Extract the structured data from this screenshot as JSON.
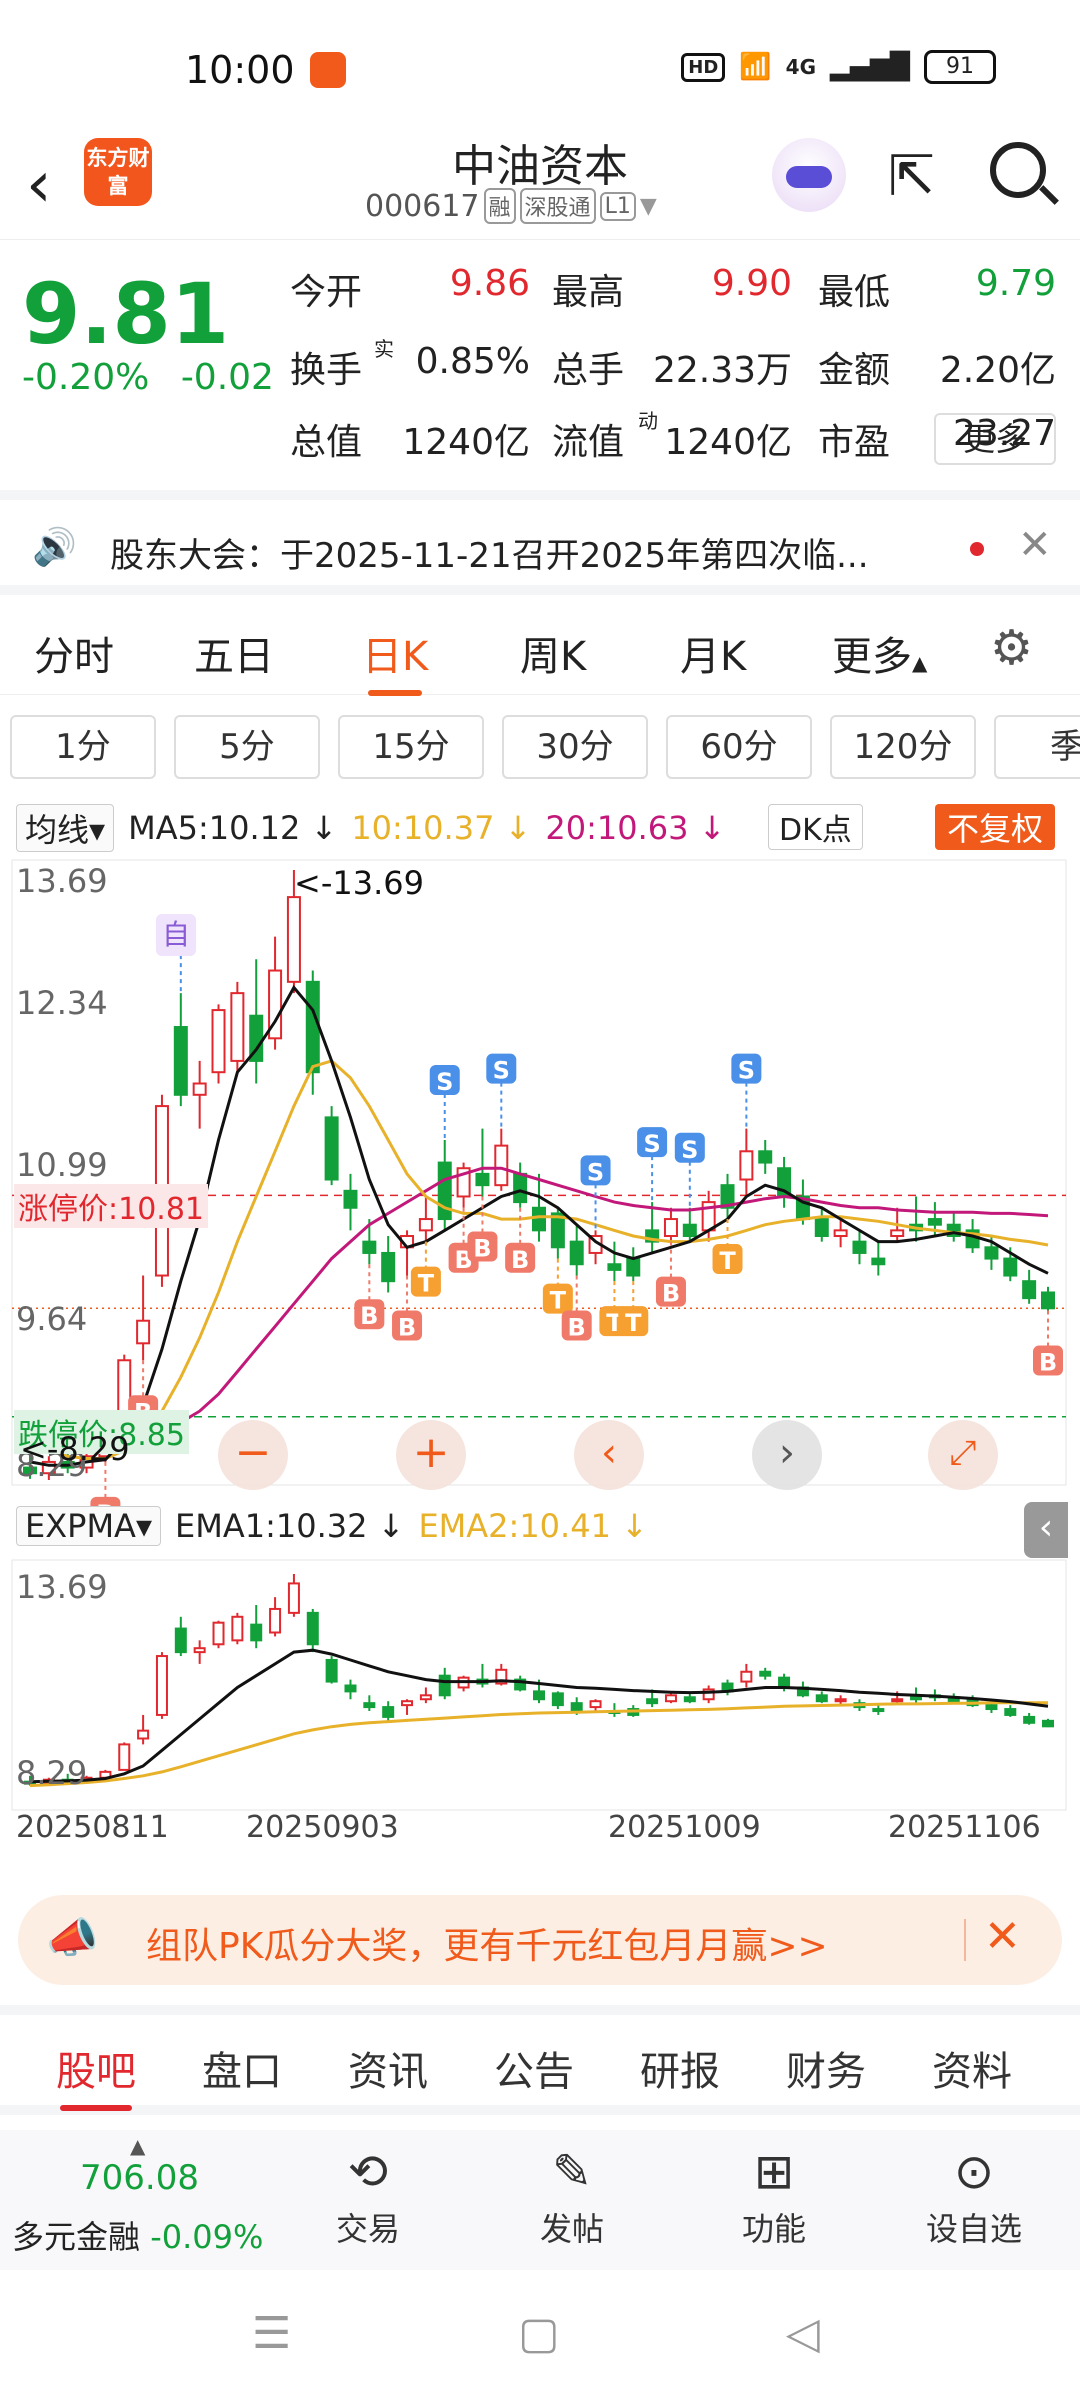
{
  "status": {
    "time": "10:00",
    "hd": "HD",
    "net": "4G",
    "battery": "91"
  },
  "header": {
    "logo": "东方财富",
    "title": "中油资本",
    "code": "000617",
    "tags": [
      "融",
      "深股通",
      "L1"
    ]
  },
  "quote": {
    "price": "9.81",
    "change_pct": "-0.20%",
    "change": "-0.02",
    "rows": [
      [
        {
          "label": "今开",
          "value": "9.86",
          "c": "red"
        },
        {
          "label": "最高",
          "value": "9.90",
          "c": "red"
        },
        {
          "label": "最低",
          "value": "9.79",
          "c": "green"
        }
      ],
      [
        {
          "label": "换手",
          "value": "0.85%",
          "c": ""
        },
        {
          "label": "总手",
          "value": "22.33万",
          "c": ""
        },
        {
          "label": "金额",
          "value": "2.20亿",
          "c": ""
        }
      ],
      [
        {
          "label": "总值",
          "value": "1240亿",
          "c": ""
        },
        {
          "label": "流值",
          "value": "1240亿",
          "c": ""
        },
        {
          "label": "市盈",
          "value": "23.27",
          "c": ""
        }
      ]
    ],
    "turnover_sup": "实",
    "pe_sup": "动",
    "more": "更多"
  },
  "notice": {
    "text": "股东大会：于2025-11-21召开2025年第四次临..."
  },
  "period_tabs": [
    "分时",
    "五日",
    "日K",
    "周K",
    "月K",
    "更多"
  ],
  "active_period": "日K",
  "minute_chips": [
    "1分",
    "5分",
    "15分",
    "30分",
    "60分",
    "120分",
    "季"
  ],
  "indicators": {
    "main": "均线",
    "ma5": "MA5:10.12",
    "ma10": "10:10.37",
    "ma20": "20:10.63",
    "dk": "DK点",
    "adjust": "不复权",
    "sub": "EXPMA",
    "ema1": "EMA1:10.32",
    "ema2": "EMA2:10.41"
  },
  "chart_data": {
    "type": "candlestick",
    "y_main": [
      "13.69",
      "12.34",
      "10.99",
      "9.64",
      "8.29"
    ],
    "y_sub": [
      "13.69",
      "8.29"
    ],
    "limit_up": "涨停价:10.81",
    "limit_down": "跌停价:8.85",
    "high_marker": "<-13.69",
    "low_marker": "<-8.29",
    "self_marker": "自",
    "dates": [
      "20250811",
      "20250903",
      "20251009",
      "20251106"
    ],
    "candles": [
      [
        8.4,
        8.55,
        8.3,
        8.35
      ],
      [
        8.35,
        8.5,
        8.29,
        8.45
      ],
      [
        8.45,
        8.6,
        8.35,
        8.4
      ],
      [
        8.4,
        8.55,
        8.35,
        8.5
      ],
      [
        8.5,
        8.7,
        8.45,
        8.65
      ],
      [
        8.7,
        9.4,
        8.7,
        9.35
      ],
      [
        9.5,
        10.1,
        9.35,
        9.7
      ],
      [
        10.1,
        11.7,
        10.0,
        11.6
      ],
      [
        12.3,
        12.6,
        11.6,
        11.7
      ],
      [
        11.7,
        12.0,
        11.4,
        11.8
      ],
      [
        11.9,
        12.5,
        11.8,
        12.45
      ],
      [
        12.0,
        12.7,
        11.9,
        12.6
      ],
      [
        12.4,
        12.9,
        11.8,
        12.0
      ],
      [
        12.2,
        13.1,
        12.1,
        12.8
      ],
      [
        12.7,
        13.69,
        12.6,
        13.45
      ],
      [
        12.7,
        12.8,
        11.7,
        11.9
      ],
      [
        11.5,
        11.6,
        10.9,
        10.95
      ],
      [
        10.85,
        11.0,
        10.5,
        10.7
      ],
      [
        10.4,
        10.6,
        10.2,
        10.3
      ],
      [
        10.3,
        10.45,
        9.95,
        10.05
      ],
      [
        10.35,
        10.5,
        10.1,
        10.45
      ],
      [
        10.5,
        10.8,
        10.4,
        10.6
      ],
      [
        11.1,
        11.3,
        10.5,
        10.6
      ],
      [
        10.8,
        11.1,
        10.7,
        11.05
      ],
      [
        11.0,
        11.4,
        10.8,
        10.9
      ],
      [
        10.9,
        11.4,
        10.85,
        11.25
      ],
      [
        11.0,
        11.1,
        10.7,
        10.75
      ],
      [
        10.7,
        11.0,
        10.4,
        10.5
      ],
      [
        10.65,
        10.7,
        10.25,
        10.35
      ],
      [
        10.4,
        10.55,
        10.1,
        10.2
      ],
      [
        10.3,
        10.5,
        10.2,
        10.45
      ],
      [
        10.2,
        10.4,
        10.05,
        10.15
      ],
      [
        10.25,
        10.35,
        10.05,
        10.1
      ],
      [
        10.5,
        10.75,
        10.3,
        10.4
      ],
      [
        10.45,
        10.7,
        10.4,
        10.6
      ],
      [
        10.55,
        10.7,
        10.4,
        10.45
      ],
      [
        10.5,
        10.85,
        10.4,
        10.75
      ],
      [
        10.9,
        11.0,
        10.6,
        10.7
      ],
      [
        10.95,
        11.4,
        10.8,
        11.2
      ],
      [
        11.2,
        11.3,
        11.0,
        11.1
      ],
      [
        11.05,
        11.15,
        10.7,
        10.8
      ],
      [
        10.8,
        10.95,
        10.55,
        10.6
      ],
      [
        10.6,
        10.7,
        10.4,
        10.45
      ],
      [
        10.45,
        10.6,
        10.35,
        10.5
      ],
      [
        10.4,
        10.5,
        10.2,
        10.3
      ],
      [
        10.25,
        10.4,
        10.1,
        10.2
      ],
      [
        10.45,
        10.7,
        10.4,
        10.5
      ],
      [
        10.55,
        10.8,
        10.4,
        10.5
      ],
      [
        10.6,
        10.75,
        10.45,
        10.55
      ],
      [
        10.55,
        10.65,
        10.4,
        10.45
      ],
      [
        10.5,
        10.6,
        10.3,
        10.35
      ],
      [
        10.35,
        10.45,
        10.15,
        10.25
      ],
      [
        10.25,
        10.35,
        10.05,
        10.1
      ],
      [
        10.05,
        10.15,
        9.85,
        9.9
      ],
      [
        9.95,
        10.0,
        9.79,
        9.81
      ]
    ],
    "ma5_line": [
      8.45,
      8.42,
      8.42,
      8.45,
      8.47,
      8.65,
      8.95,
      9.45,
      10.05,
      10.6,
      11.3,
      11.9,
      12.1,
      12.35,
      12.65,
      12.45,
      12.0,
      11.5,
      10.95,
      10.55,
      10.35,
      10.4,
      10.5,
      10.6,
      10.7,
      10.8,
      10.85,
      10.8,
      10.7,
      10.55,
      10.4,
      10.3,
      10.25,
      10.3,
      10.35,
      10.4,
      10.5,
      10.6,
      10.8,
      10.9,
      10.85,
      10.75,
      10.7,
      10.6,
      10.5,
      10.4,
      10.4,
      10.42,
      10.45,
      10.48,
      10.45,
      10.4,
      10.3,
      10.2,
      10.12
    ],
    "ma10_line": [
      8.6,
      8.55,
      8.5,
      8.48,
      8.48,
      8.55,
      8.68,
      8.9,
      9.2,
      9.55,
      9.95,
      10.4,
      10.8,
      11.2,
      11.6,
      11.95,
      12.0,
      11.85,
      11.6,
      11.3,
      11.0,
      10.8,
      10.7,
      10.65,
      10.65,
      10.6,
      10.6,
      10.62,
      10.62,
      10.6,
      10.55,
      10.5,
      10.45,
      10.42,
      10.4,
      10.4,
      10.42,
      10.45,
      10.5,
      10.55,
      10.58,
      10.6,
      10.62,
      10.62,
      10.6,
      10.58,
      10.55,
      10.52,
      10.5,
      10.48,
      10.47,
      10.45,
      10.42,
      10.4,
      10.37
    ],
    "ma20_line": [
      8.85,
      8.8,
      8.75,
      8.7,
      8.65,
      8.65,
      8.68,
      8.72,
      8.8,
      8.9,
      9.05,
      9.25,
      9.45,
      9.65,
      9.85,
      10.05,
      10.25,
      10.4,
      10.55,
      10.65,
      10.75,
      10.85,
      10.95,
      11.0,
      11.05,
      11.05,
      11.0,
      10.95,
      10.9,
      10.85,
      10.8,
      10.75,
      10.72,
      10.7,
      10.68,
      10.68,
      10.7,
      10.72,
      10.75,
      10.78,
      10.8,
      10.78,
      10.75,
      10.72,
      10.7,
      10.7,
      10.68,
      10.67,
      10.66,
      10.66,
      10.66,
      10.65,
      10.65,
      10.64,
      10.63
    ],
    "ema1_line": [
      8.4,
      8.41,
      8.42,
      8.44,
      8.48,
      8.6,
      8.8,
      9.2,
      9.6,
      10.0,
      10.4,
      10.8,
      11.1,
      11.4,
      11.7,
      11.75,
      11.65,
      11.5,
      11.35,
      11.2,
      11.1,
      11.0,
      10.95,
      10.95,
      10.95,
      10.97,
      10.95,
      10.9,
      10.85,
      10.8,
      10.78,
      10.75,
      10.72,
      10.7,
      10.68,
      10.67,
      10.68,
      10.7,
      10.75,
      10.8,
      10.8,
      10.78,
      10.75,
      10.72,
      10.68,
      10.65,
      10.62,
      10.6,
      10.58,
      10.55,
      10.52,
      10.48,
      10.44,
      10.38,
      10.32
    ],
    "ema2_line": [
      8.3,
      8.32,
      8.35,
      8.38,
      8.42,
      8.48,
      8.55,
      8.65,
      8.78,
      8.92,
      9.06,
      9.2,
      9.34,
      9.48,
      9.62,
      9.72,
      9.8,
      9.86,
      9.9,
      9.93,
      9.96,
      9.99,
      10.02,
      10.05,
      10.08,
      10.11,
      10.13,
      10.15,
      10.16,
      10.17,
      10.18,
      10.19,
      10.2,
      10.21,
      10.22,
      10.23,
      10.24,
      10.26,
      10.28,
      10.3,
      10.32,
      10.33,
      10.34,
      10.35,
      10.36,
      10.37,
      10.38,
      10.38,
      10.39,
      10.4,
      10.4,
      10.41,
      10.41,
      10.41,
      10.41
    ],
    "signals": [
      {
        "i": 4,
        "t": "B"
      },
      {
        "i": 6,
        "t": "B"
      },
      {
        "i": 8,
        "t": "S"
      },
      {
        "i": 18,
        "t": "B"
      },
      {
        "i": 20,
        "t": "B"
      },
      {
        "i": 21,
        "t": "T"
      },
      {
        "i": 22,
        "t": "S"
      },
      {
        "i": 23,
        "t": "B"
      },
      {
        "i": 24,
        "t": "B"
      },
      {
        "i": 25,
        "t": "S"
      },
      {
        "i": 26,
        "t": "B"
      },
      {
        "i": 28,
        "t": "T"
      },
      {
        "i": 29,
        "t": "B"
      },
      {
        "i": 30,
        "t": "S"
      },
      {
        "i": 31,
        "t": "T"
      },
      {
        "i": 32,
        "t": "T"
      },
      {
        "i": 33,
        "t": "S"
      },
      {
        "i": 34,
        "t": "B"
      },
      {
        "i": 35,
        "t": "S"
      },
      {
        "i": 37,
        "t": "T"
      },
      {
        "i": 38,
        "t": "S"
      },
      {
        "i": 54,
        "t": "B"
      }
    ]
  },
  "banner": {
    "text": "组队PK瓜分大奖，更有千元红包月月赢>>"
  },
  "bottom_tabs": [
    "股吧",
    "盘口",
    "资讯",
    "公告",
    "研报",
    "财务",
    "资料"
  ],
  "toolbar": {
    "index_value": "706.08",
    "index_name": "多元金融",
    "index_change": "-0.09%",
    "items": [
      "交易",
      "发帖",
      "功能",
      "设自选"
    ]
  }
}
